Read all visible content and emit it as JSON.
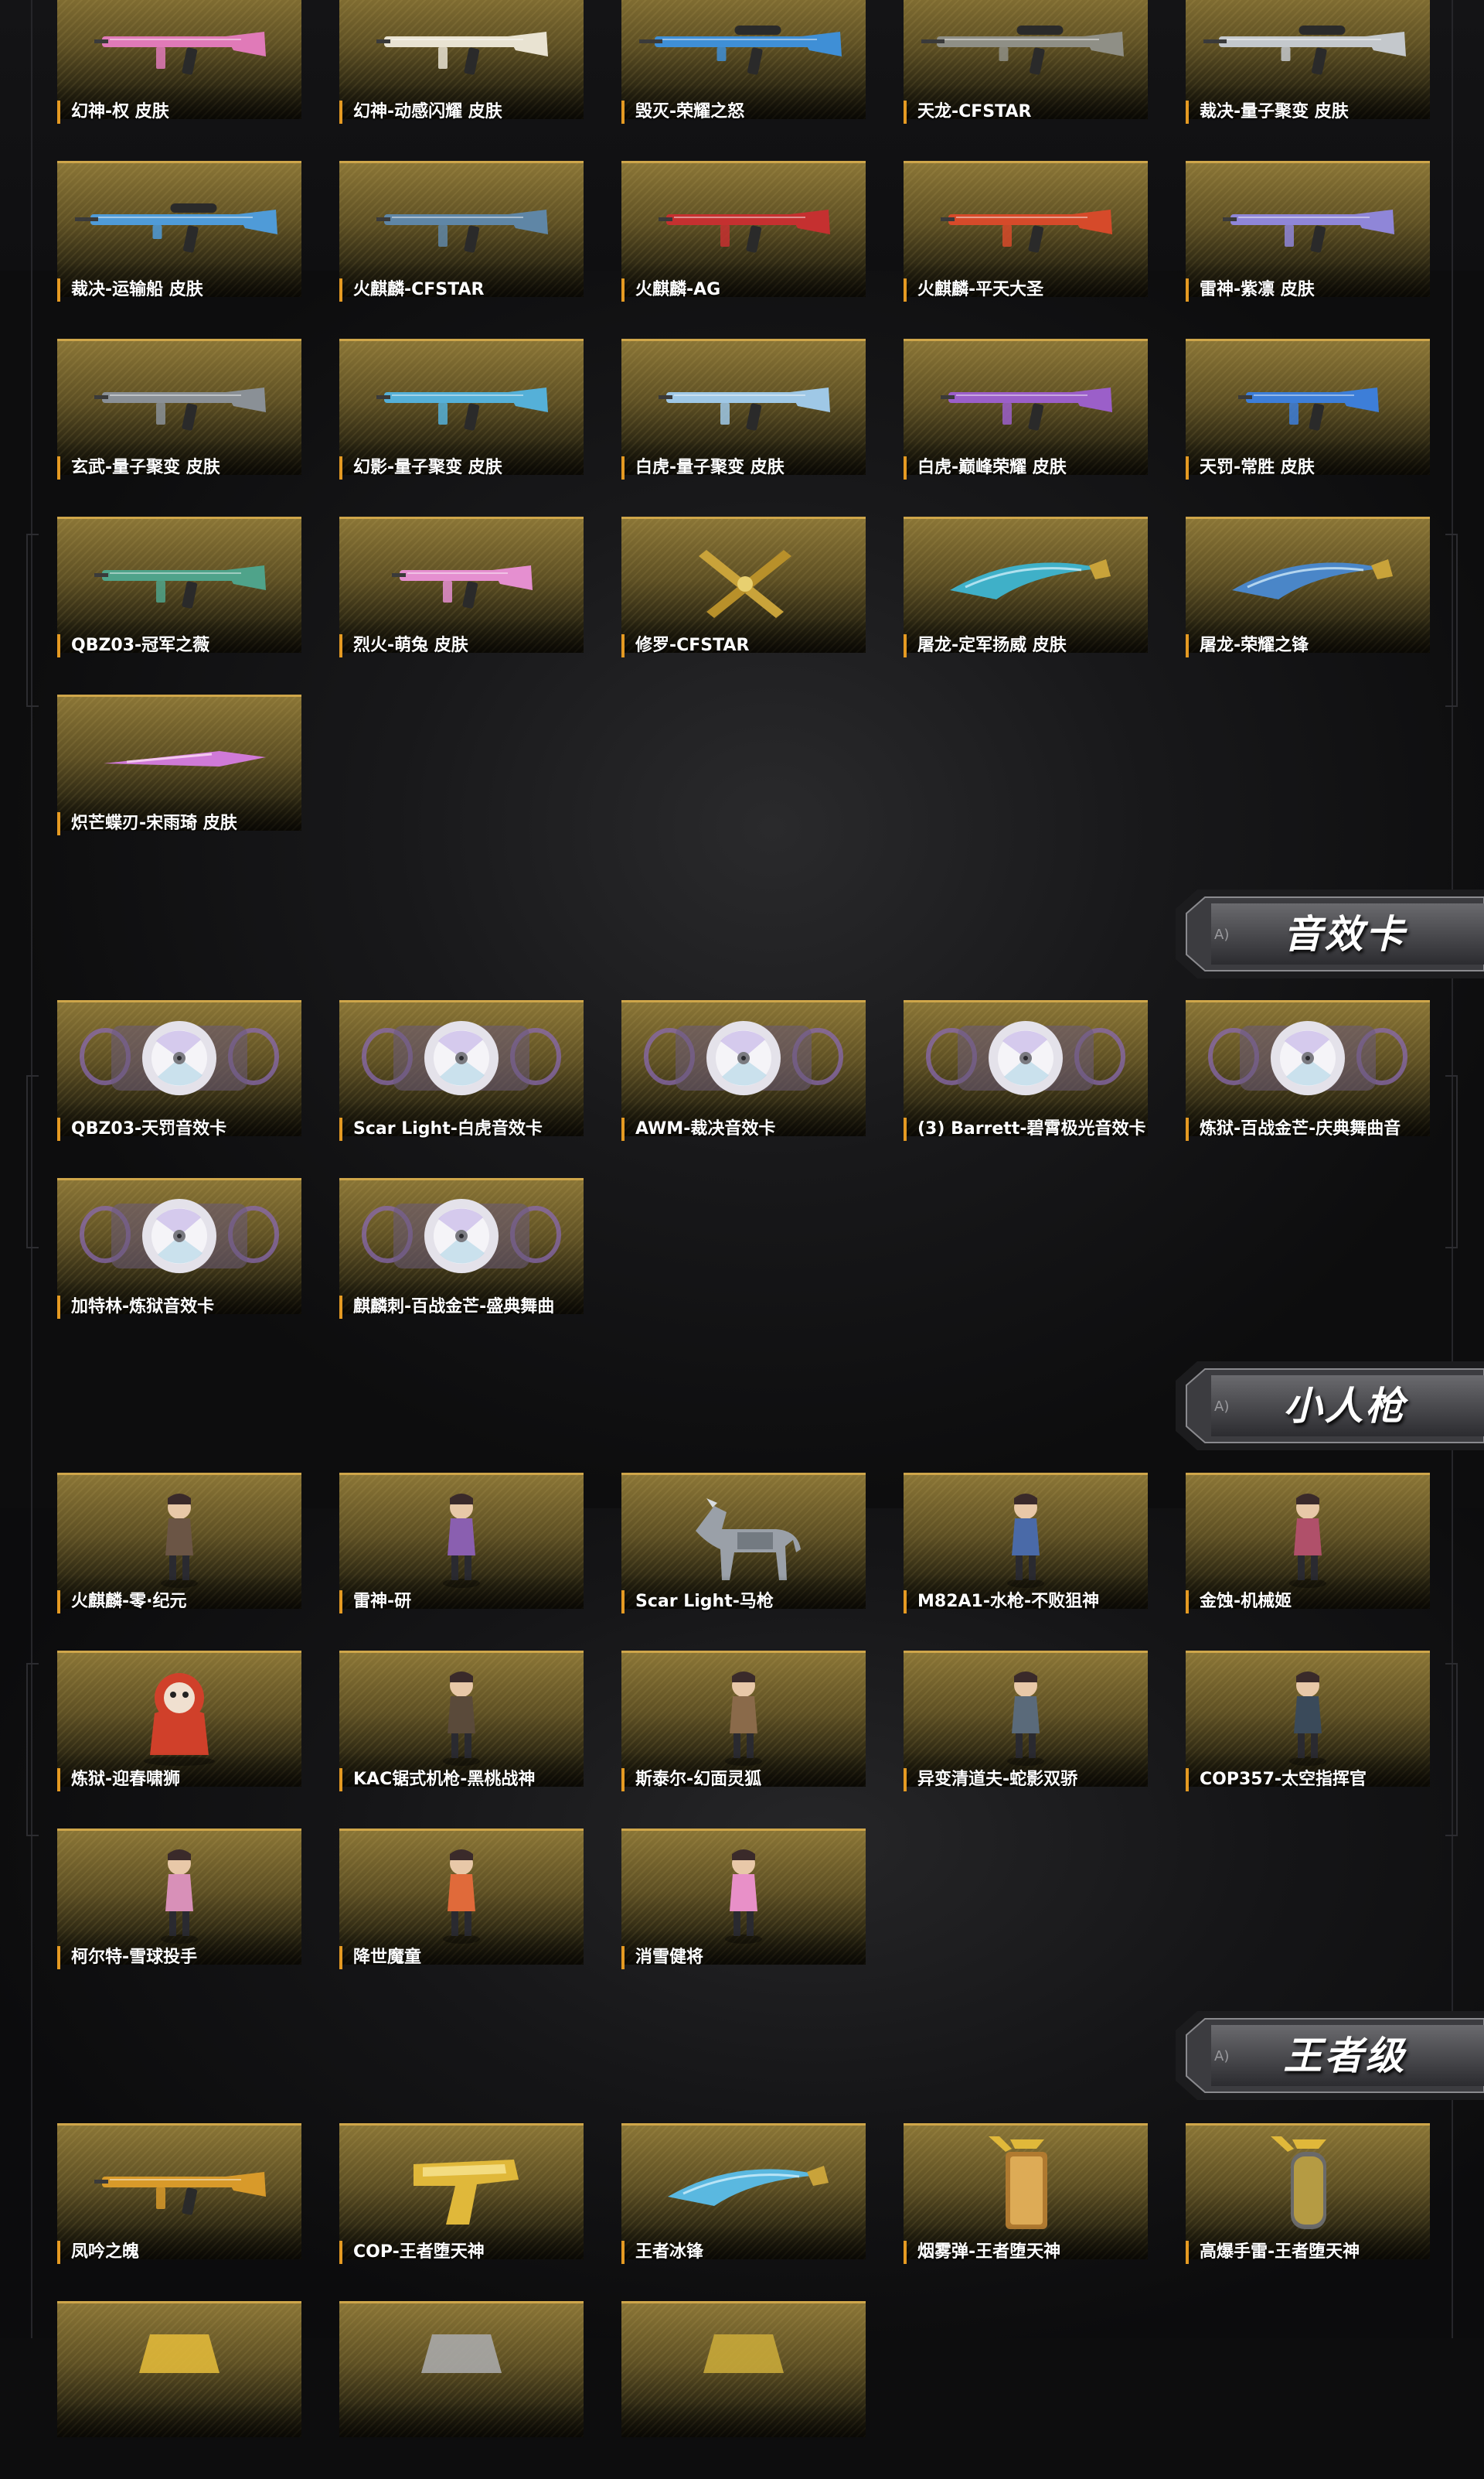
{
  "colors": {
    "page_background": "#0d0d0e",
    "card_gold": "#8a7536",
    "card_border": "#cfa64a",
    "label_accent": "#e59a22",
    "label_text": "#ffffff"
  },
  "weapon_skins": {
    "items": [
      {
        "label": "幻神-权 皮肤",
        "icon": "pink-rifle-icon",
        "accent": "#e07ab8"
      },
      {
        "label": "幻神-动感闪耀 皮肤",
        "icon": "white-rifle-icon",
        "accent": "#e9e3d2"
      },
      {
        "label": "毁灭-荣耀之怒",
        "icon": "blue-gold-sniper-icon",
        "accent": "#3f8fd6"
      },
      {
        "label": "天龙-CFSTAR",
        "icon": "dark-sniper-icon",
        "accent": "#8f8f86"
      },
      {
        "label": "裁决-量子聚变 皮肤",
        "icon": "silver-sniper-icon",
        "accent": "#c4c8cc"
      },
      {
        "label": "裁决-运输船 皮肤",
        "icon": "blue-sniper-icon",
        "accent": "#4f9bd8"
      },
      {
        "label": "火麒麟-CFSTAR",
        "icon": "gold-rifle-icon",
        "accent": "#5f86a6"
      },
      {
        "label": "火麒麟-AG",
        "icon": "red-rifle-icon",
        "accent": "#c53030"
      },
      {
        "label": "火麒麟-平天大圣",
        "icon": "red-gold-rifle-icon",
        "accent": "#d64a2a"
      },
      {
        "label": "雷神-紫凛 皮肤",
        "icon": "purple-rifle-icon",
        "accent": "#8f86d8"
      },
      {
        "label": "玄武-量子聚变 皮肤",
        "icon": "grey-rifle-icon",
        "accent": "#8a9096"
      },
      {
        "label": "幻影-量子聚变 皮肤",
        "icon": "cyan-rifle-icon",
        "accent": "#55b0d8"
      },
      {
        "label": "白虎-量子聚变 皮肤",
        "icon": "white-blue-rifle-icon",
        "accent": "#9fc8e6"
      },
      {
        "label": "白虎-巅峰荣耀 皮肤",
        "icon": "purple-gold-rifle-icon",
        "accent": "#9b5fc9"
      },
      {
        "label": "天罚-常胜 皮肤",
        "icon": "blue-smg-icon",
        "accent": "#3d7ed8"
      },
      {
        "label": "QBZ03-冠军之薇",
        "icon": "green-rifle-icon",
        "accent": "#4fa38a"
      },
      {
        "label": "烈火-萌兔 皮肤",
        "icon": "pink-smg-icon",
        "accent": "#e58fd0"
      },
      {
        "label": "修罗-CFSTAR",
        "icon": "crossed-blades-icon",
        "accent": "#c9a33a"
      },
      {
        "label": "屠龙-定军扬威 皮肤",
        "icon": "cyan-blade-icon",
        "accent": "#3fb0c8"
      },
      {
        "label": "屠龙-荣耀之锋",
        "icon": "blue-blade-icon",
        "accent": "#4a86c8"
      },
      {
        "label": "炽芒蝶刃-宋雨琦 皮肤",
        "icon": "butterfly-knife-icon",
        "accent": "#d07ad8"
      }
    ]
  },
  "sound_cards": {
    "title": "音效卡",
    "items": [
      {
        "label": "QBZ03-天罚音效卡",
        "icon": "disc-icon"
      },
      {
        "label": "Scar Light-白虎音效卡",
        "icon": "disc-icon"
      },
      {
        "label": "AWM-裁决音效卡",
        "icon": "disc-icon"
      },
      {
        "label": "(3) Barrett-碧霄极光音效卡",
        "icon": "disc-icon"
      },
      {
        "label": "炼狱-百战金芒-庆典舞曲音",
        "icon": "disc-icon"
      },
      {
        "label": "加特林-炼狱音效卡",
        "icon": "disc-icon"
      },
      {
        "label": "麒麟刺-百战金芒-盛典舞曲",
        "icon": "disc-icon"
      }
    ]
  },
  "figure_guns": {
    "title": "小人枪",
    "items": [
      {
        "label": "火麒麟-零·纪元",
        "icon": "character-figure-icon",
        "accent": "#6b5545"
      },
      {
        "label": "雷神-研",
        "icon": "character-figure-icon",
        "accent": "#8a5fb0"
      },
      {
        "label": "Scar Light-马枪",
        "icon": "horse-figure-icon",
        "accent": "#9aa0a8"
      },
      {
        "label": "M82A1-水枪-不败狙神",
        "icon": "character-figure-icon",
        "accent": "#4a6aa8"
      },
      {
        "label": "金蚀-机械姬",
        "icon": "character-figure-icon",
        "accent": "#b0506a"
      },
      {
        "label": "炼狱-迎春啸狮",
        "icon": "lion-figure-icon",
        "accent": "#d0402a"
      },
      {
        "label": "KAC锯式机枪-黑桃战神",
        "icon": "character-figure-icon",
        "accent": "#5a4a3a"
      },
      {
        "label": "斯泰尔-幻面灵狐",
        "icon": "character-figure-icon",
        "accent": "#8a6a4a"
      },
      {
        "label": "异变清道夫-蛇影双骄",
        "icon": "character-figure-icon",
        "accent": "#5a6a7a"
      },
      {
        "label": "COP357-太空指挥官",
        "icon": "character-figure-icon",
        "accent": "#3a4a5a"
      },
      {
        "label": "柯尔特-雪球投手",
        "icon": "character-figure-icon",
        "accent": "#d890b8"
      },
      {
        "label": "降世魔童",
        "icon": "character-figure-icon",
        "accent": "#e06a3a"
      },
      {
        "label": "消雪健将",
        "icon": "character-figure-icon",
        "accent": "#e890c8"
      }
    ]
  },
  "king_class": {
    "title": "王者级",
    "items": [
      {
        "label": "凤吟之魄",
        "icon": "gold-rifle-icon",
        "accent": "#d89a2a"
      },
      {
        "label": "COP-王者堕天神",
        "icon": "gold-pistol-icon",
        "accent": "#e0b83a"
      },
      {
        "label": "王者冰锋",
        "icon": "ice-blade-icon",
        "accent": "#5ab8e0"
      },
      {
        "label": "烟雾弹-王者堕天神",
        "icon": "smoke-grenade-icon",
        "accent": "#e0b83a"
      },
      {
        "label": "高爆手雷-王者堕天神",
        "icon": "frag-grenade-icon",
        "accent": "#e0b83a"
      },
      {
        "label": "",
        "icon": "gold-item-icon",
        "accent": "#e0b83a"
      },
      {
        "label": "",
        "icon": "gold-item-icon",
        "accent": "#a8a8a8"
      },
      {
        "label": "",
        "icon": "gold-item-icon",
        "accent": "#c8a83a"
      }
    ]
  }
}
